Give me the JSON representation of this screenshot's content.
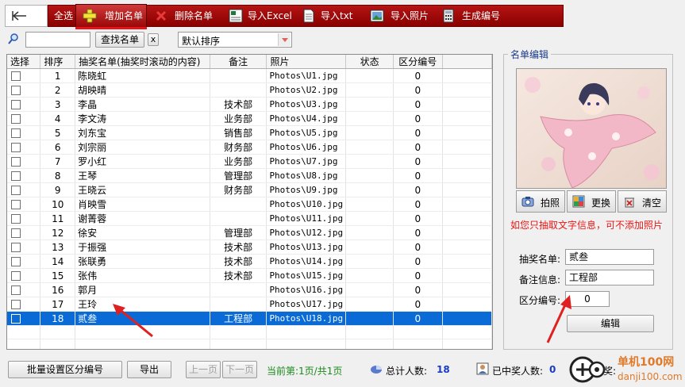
{
  "toolbar": {
    "buttons": [
      {
        "label": "全选",
        "icon": "check-all-icon"
      },
      {
        "label": "增加名单",
        "icon": "plus-icon"
      },
      {
        "label": "删除名单",
        "icon": "delete-x-icon"
      },
      {
        "label": "导入Excel",
        "icon": "excel-icon"
      },
      {
        "label": "导入txt",
        "icon": "txt-file-icon"
      },
      {
        "label": "导入照片",
        "icon": "image-icon"
      },
      {
        "label": "生成编号",
        "icon": "calculator-icon"
      }
    ]
  },
  "search": {
    "value": "",
    "find_label": "查找名单",
    "clear_label": "x",
    "sort_value": "默认排序"
  },
  "table": {
    "headers": [
      "选择",
      "排序",
      "抽奖名单(抽奖时滚动的内容)",
      "备注",
      "照片",
      "状态",
      "区分编号"
    ],
    "rows": [
      {
        "no": "1",
        "name": "陈晓虹",
        "note": "",
        "photo": "Photos\\U1.jpg",
        "status": "",
        "code": "0"
      },
      {
        "no": "2",
        "name": "胡映晴",
        "note": "",
        "photo": "Photos\\U2.jpg",
        "status": "",
        "code": "0"
      },
      {
        "no": "3",
        "name": "李晶",
        "note": "技术部",
        "photo": "Photos\\U3.jpg",
        "status": "",
        "code": "0"
      },
      {
        "no": "4",
        "name": "李文涛",
        "note": "业务部",
        "photo": "Photos\\U4.jpg",
        "status": "",
        "code": "0"
      },
      {
        "no": "5",
        "name": "刘东宝",
        "note": "销售部",
        "photo": "Photos\\U5.jpg",
        "status": "",
        "code": "0"
      },
      {
        "no": "6",
        "name": "刘宗丽",
        "note": "财务部",
        "photo": "Photos\\U6.jpg",
        "status": "",
        "code": "0"
      },
      {
        "no": "7",
        "name": "罗小红",
        "note": "业务部",
        "photo": "Photos\\U7.jpg",
        "status": "",
        "code": "0"
      },
      {
        "no": "8",
        "name": "王琴",
        "note": "管理部",
        "photo": "Photos\\U8.jpg",
        "status": "",
        "code": "0"
      },
      {
        "no": "9",
        "name": "王晓云",
        "note": "财务部",
        "photo": "Photos\\U9.jpg",
        "status": "",
        "code": "0"
      },
      {
        "no": "10",
        "name": "肖映雪",
        "note": "",
        "photo": "Photos\\U10.jpg",
        "status": "",
        "code": "0"
      },
      {
        "no": "11",
        "name": "谢菁蓉",
        "note": "",
        "photo": "Photos\\U11.jpg",
        "status": "",
        "code": "0"
      },
      {
        "no": "12",
        "name": "徐安",
        "note": "管理部",
        "photo": "Photos\\U12.jpg",
        "status": "",
        "code": "0"
      },
      {
        "no": "13",
        "name": "于振强",
        "note": "技术部",
        "photo": "Photos\\U13.jpg",
        "status": "",
        "code": "0"
      },
      {
        "no": "14",
        "name": "张联勇",
        "note": "技术部",
        "photo": "Photos\\U14.jpg",
        "status": "",
        "code": "0"
      },
      {
        "no": "15",
        "name": "张伟",
        "note": "技术部",
        "photo": "Photos\\U15.jpg",
        "status": "",
        "code": "0"
      },
      {
        "no": "16",
        "name": "郭月",
        "note": "",
        "photo": "Photos\\U16.jpg",
        "status": "",
        "code": "0"
      },
      {
        "no": "17",
        "name": "王玲",
        "note": "",
        "photo": "Photos\\U17.jpg",
        "status": "",
        "code": "0"
      },
      {
        "no": "18",
        "name": "贰叁",
        "note": "工程部",
        "photo": "Photos\\U18.jpg",
        "status": "",
        "code": "0"
      }
    ]
  },
  "editor": {
    "title": "名单编辑",
    "photo_buttons": [
      {
        "label": "拍照",
        "icon": "camera-icon"
      },
      {
        "label": "更换",
        "icon": "change-photo-icon"
      },
      {
        "label": "清空",
        "icon": "trash-icon"
      }
    ],
    "notice": "如您只抽取文字信息，可不添加照片",
    "name_label": "抽奖名单:",
    "name_value": "贰叁",
    "note_label": "备注信息:",
    "note_value": "工程部",
    "code_label": "区分编号:",
    "code_value": "0",
    "edit_button": "编辑"
  },
  "footer": {
    "batch_button": "批量设置区分编号",
    "export_button": "导出",
    "prev_button": "上一页",
    "next_button": "下一页",
    "page_info": "当前第:1页/共1页",
    "total_label": "总计人数:",
    "total_value": "18",
    "winners_label": "已中奖人数:",
    "winners_value": "0",
    "truncated_label": "奖:"
  },
  "watermark": {
    "brand": "单机100网",
    "url": "danji100.com"
  },
  "colors": {
    "toolbar_red": "#9a0808",
    "selection_blue": "#0a6bd6",
    "notice_red": "#e81818",
    "page_info_green": "#1a8a1a",
    "count_blue": "#1a3ac8"
  }
}
